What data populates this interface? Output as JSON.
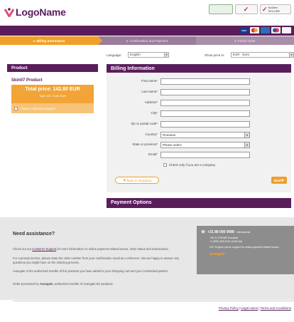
{
  "header": {
    "logo_text": "LogoName",
    "badges": [
      "",
      "",
      "McAfee SECURE"
    ],
    "cards": [
      "VISA",
      "",
      "",
      "",
      ""
    ]
  },
  "steps": [
    "1. Billing Information",
    "2. Confirmation and Payment",
    "3. Finish Order"
  ],
  "language": {
    "label": "Language:",
    "value": "English"
  },
  "price_in": {
    "label": "Show price in:",
    "value": "EUR - Euro"
  },
  "product": {
    "header": "Product",
    "name": "Skin07 Product",
    "total": "Total price: 142.80 EUR",
    "vat": "Total VAT: 23.80 EUR",
    "coupon": "I have a discount coupon"
  },
  "billing": {
    "header": "Billing Information",
    "fields": [
      {
        "label": "First name*",
        "value": ""
      },
      {
        "label": "Last name*",
        "value": ""
      },
      {
        "label": "Address*",
        "value": ""
      },
      {
        "label": "City*",
        "value": ""
      },
      {
        "label": "Zip or postal code*",
        "value": ""
      },
      {
        "label": "Country*",
        "value": "Romania"
      },
      {
        "label": "State or province*",
        "value": "Please select"
      },
      {
        "label": "Email*",
        "value": ""
      }
    ],
    "company_label": "Check only if you are a company",
    "back_label": "Back to shopping",
    "next_label": "Next"
  },
  "payment_header": "Payment Options",
  "assist": {
    "title": "Need assistance?",
    "p1a": "Check out our ",
    "p1_link": "Customer Support",
    "p1b": " for more information on online payment related issues, order status and transactions.",
    "p2": "For a prompt service, please state the order number from your confirmation email as a reference. We are happy to answer any questions you might have on the ordering process.",
    "p3": "Avangate is the authorized reseller of the products you have added to your shopping cart and your contractual partner.",
    "p4a": "Order processed by ",
    "p4_brand": "Avangate",
    "p4b": ", authorized reseller of Avangate BV products.",
    "phone": "+31 88 000 0008",
    "phone_intl": "International",
    "lines": [
      "+40 31 PHONE Romania",
      "+1 (650) 963-5701 (USA Intl)",
      "24/7 English phone support for online payment related issues"
    ],
    "brand": "avangate"
  },
  "footer": {
    "privacy": "Privacy Policy",
    "legal": "Legal notice",
    "terms": "Terms and Conditions"
  }
}
